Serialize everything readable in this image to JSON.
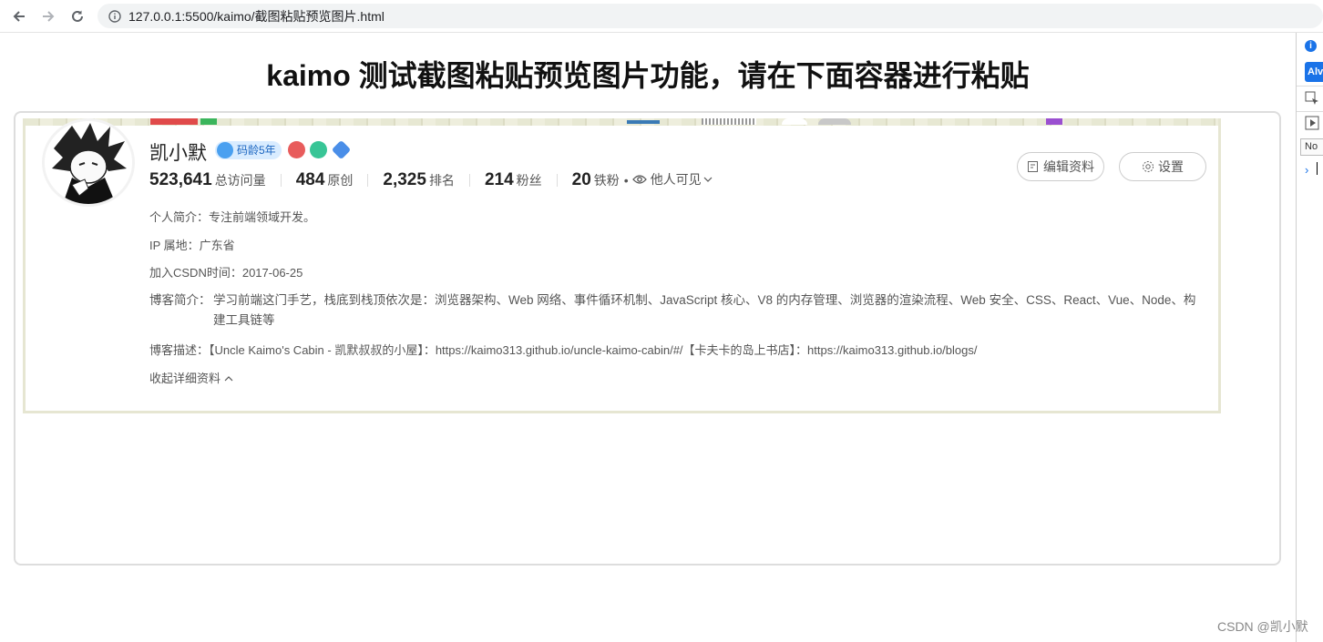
{
  "browser": {
    "url": "127.0.0.1:5500/kaimo/截图粘贴预览图片.html"
  },
  "devtools": {
    "info_badge": "i",
    "al_badge": "Alv",
    "no_field": "No",
    "chevron": "›"
  },
  "page": {
    "heading": "kaimo 测试截图粘贴预览图片功能，请在下面容器进行粘贴"
  },
  "profile": {
    "name": "凯小默",
    "code_age_badge": "码龄5年",
    "stats": [
      {
        "value": "523,641",
        "label": "总访问量"
      },
      {
        "value": "484",
        "label": "原创"
      },
      {
        "value": "2,325",
        "label": "排名"
      },
      {
        "value": "214",
        "label": "粉丝"
      },
      {
        "value": "20",
        "label": "铁粉"
      }
    ],
    "dot": "•",
    "visibility": "他人可见",
    "edit_button": "编辑资料",
    "settings_button": "设置",
    "intro_label": "个人简介：",
    "intro_value": "专注前端领域开发。",
    "ip_label": "IP 属地：",
    "ip_value": "广东省",
    "join_label": "加入CSDN时间：",
    "join_value": "2017-06-25",
    "blog_intro_label": "博客简介：",
    "blog_intro_value": "学习前端这门手艺，栈底到栈顶依次是：浏览器架构、Web 网络、事件循环机制、JavaScript 核心、V8 的内存管理、浏览器的渲染流程、Web 安全、CSS、React、Vue、Node、构建工具链等",
    "blog_desc_label": "博客描述：",
    "blog_desc_value": "【Uncle Kaimo's Cabin - 凯默叔叔的小屋】：https://kaimo313.github.io/uncle-kaimo-cabin/#/【卡夫卡的岛上书店】：https://kaimo313.github.io/blogs/",
    "collapse_link": "收起详细资料"
  },
  "watermark": "CSDN @凯小默"
}
